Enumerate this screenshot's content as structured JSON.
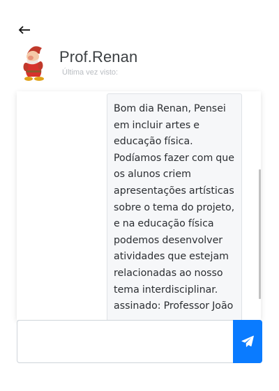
{
  "header": {
    "back_icon": "arrow-left-icon",
    "avatar_icon": "dwarf-avatar-icon",
    "contact_name": "Prof.Renan",
    "last_seen": "Última vez visto:"
  },
  "chat": {
    "messages": [
      {
        "text": "Bom dia Renan, Pensei em incluir artes e educação física. Podíamos fazer com que os alunos criem apresentações artísticas sobre o tema do projeto, e na educação física podemos desenvolver atividades que estejam relacionadas ao nosso tema interdisciplinar. assinado: Professor João"
      }
    ]
  },
  "composer": {
    "input_value": "",
    "send_icon": "paper-plane-icon"
  },
  "colors": {
    "accent": "#0a7bff",
    "bubble_bg": "#f6f7f9",
    "text": "#2a2d31"
  }
}
